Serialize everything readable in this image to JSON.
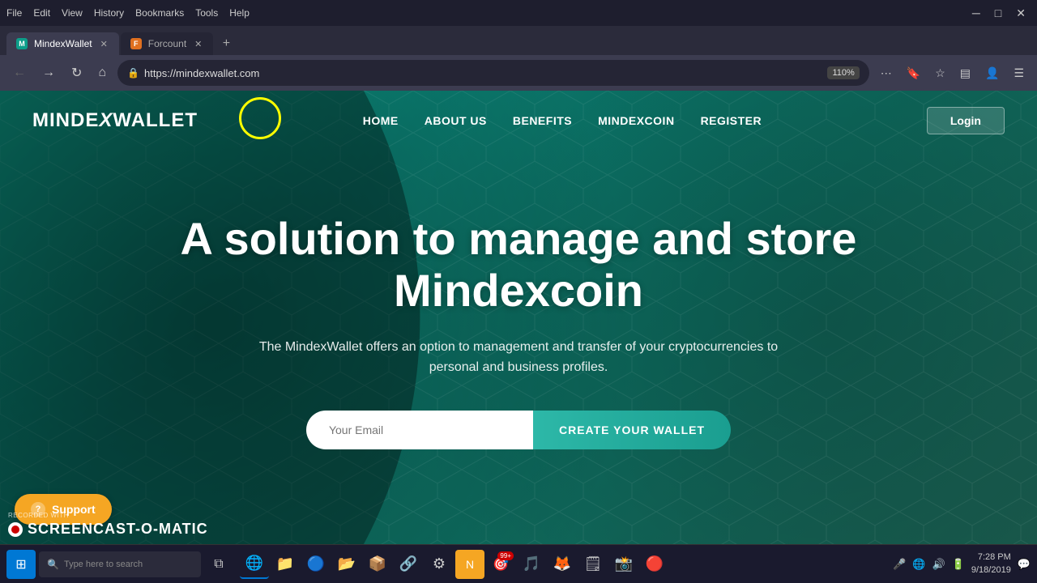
{
  "browser": {
    "title_bar": {
      "menu_items": [
        "File",
        "Edit",
        "View",
        "History",
        "Bookmarks",
        "Tools",
        "Help"
      ]
    },
    "tabs": [
      {
        "id": "tab1",
        "label": "MindexWallet",
        "url": "https://mindexwallet.com",
        "active": true,
        "favicon": "M"
      },
      {
        "id": "tab2",
        "label": "Forcount",
        "url": "",
        "active": false,
        "favicon": "F"
      }
    ],
    "address_bar": {
      "url": "https://mindexwallet.com",
      "zoom": "110%"
    }
  },
  "website": {
    "logo": "MINDEX WALLET",
    "nav": {
      "items": [
        "HOME",
        "ABOUT US",
        "BENEFITS",
        "MINDEXCOIN",
        "REGISTER"
      ],
      "login_label": "Login"
    },
    "hero": {
      "title": "A solution to manage and store Mindexcoin",
      "subtitle": "The MindexWallet offers an option to management and transfer of your cryptocurrencies to personal and business profiles.",
      "email_placeholder": "Your Email",
      "cta_button": "CREATE YOUR WALLET"
    },
    "support": {
      "label": "Support"
    }
  },
  "taskbar": {
    "search_placeholder": "Type here to search",
    "time": "7:28 PM",
    "date": "9/18/2019",
    "icons": [
      "⊞",
      "🗂",
      "📁",
      "🌐",
      "📦",
      "⚙",
      "📋",
      "🎵",
      "🔥",
      "📸",
      "🔊"
    ]
  },
  "screencast": {
    "recorded_with": "RECORDED WITH",
    "logo": "SCREENCAST-O-MATIC"
  }
}
